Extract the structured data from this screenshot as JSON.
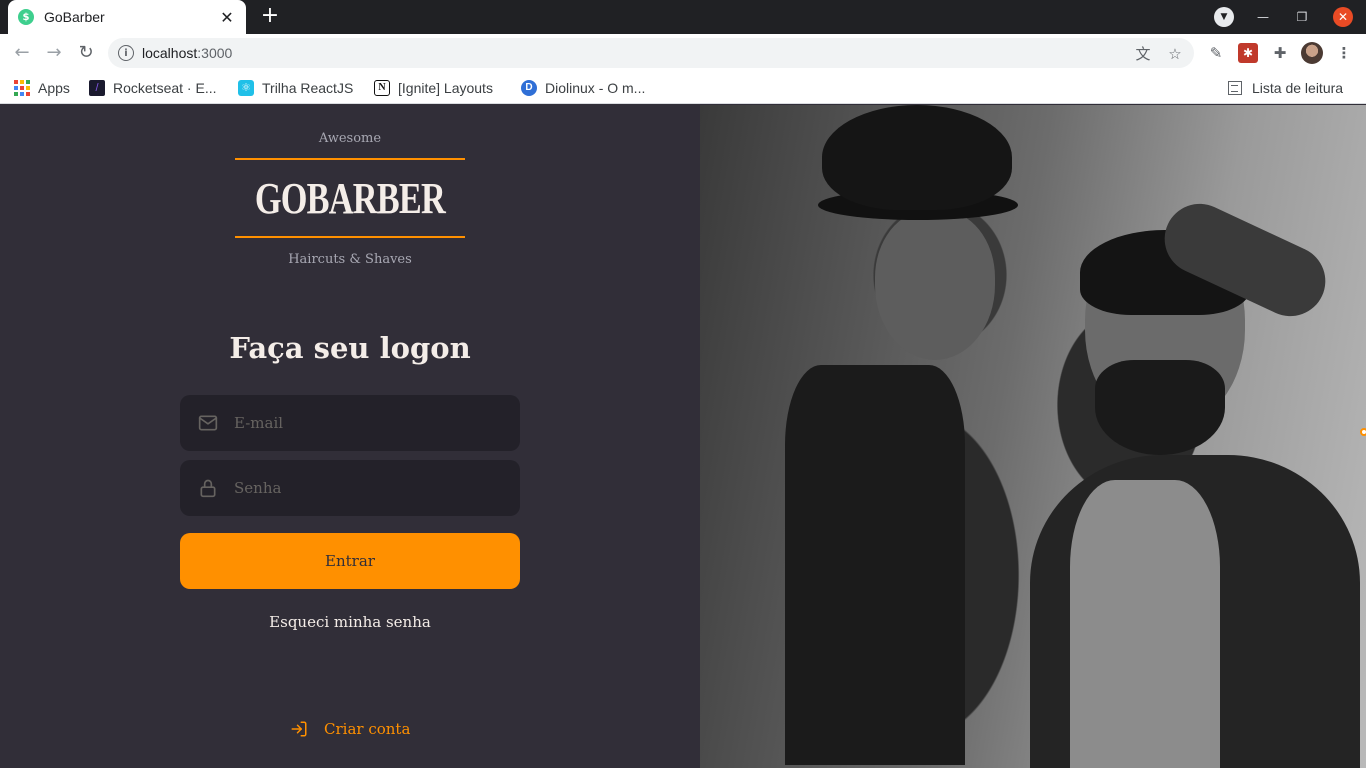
{
  "browser": {
    "tab_title": "GoBarber",
    "tab_favicon": "$",
    "url_host": "localhost",
    "url_port": ":3000",
    "bookmarks": [
      {
        "label": "Apps",
        "icon": "apps-grid-icon"
      },
      {
        "label": "Rocketseat · E...",
        "icon": "rocketseat-icon"
      },
      {
        "label": "Trilha ReactJS",
        "icon": "react-icon"
      },
      {
        "label": "[Ignite] Layouts",
        "icon": "notion-icon"
      },
      {
        "label": "Diolinux - O m...",
        "icon": "diolinux-icon"
      }
    ],
    "reading_list": "Lista de leitura"
  },
  "brand": {
    "top": "Awesome",
    "name": "GOBARBER",
    "bottom": "Haircuts & Shaves"
  },
  "form": {
    "title": "Faça seu logon",
    "email_placeholder": "E-mail",
    "password_placeholder": "Senha",
    "submit_label": "Entrar",
    "forgot_label": "Esqueci minha senha"
  },
  "create_account": {
    "label": "Criar conta"
  },
  "colors": {
    "background": "#312e38",
    "input_bg": "#232129",
    "accent": "#ff9000",
    "text": "#f4ede8",
    "muted": "#666360"
  }
}
